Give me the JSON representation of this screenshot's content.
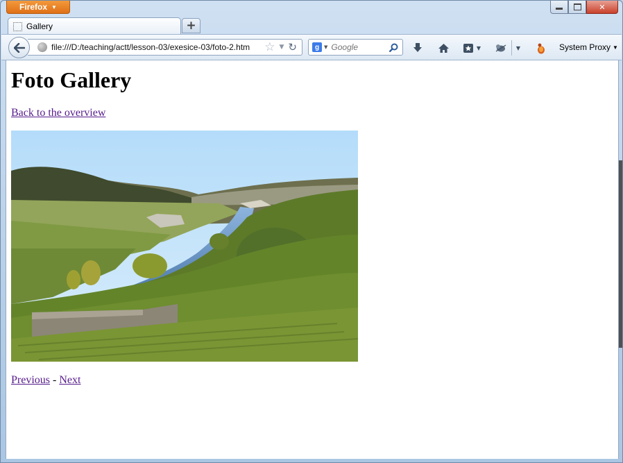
{
  "browser": {
    "app_button_label": "Firefox",
    "tab_title": "Gallery",
    "new_tab_label": "+",
    "url": "file:///D:/teaching/actt/lesson-03/exesice-03/foto-2.htm",
    "search_placeholder": "Google",
    "search_engine_letter": "g",
    "proxy_label": "System Proxy",
    "icons": [
      "back-arrow-icon",
      "globe-icon",
      "star-icon",
      "dropdown-icon",
      "reload-icon",
      "google-icon",
      "search-icon",
      "download-icon",
      "home-icon",
      "bookmarks-icon",
      "addon-icon",
      "firebug-icon",
      "minimize-icon",
      "maximize-icon",
      "close-icon"
    ]
  },
  "page": {
    "heading": "Foto Gallery",
    "back_link": "Back to the overview",
    "prev_link": "Previous",
    "separator": " - ",
    "next_link": "Next"
  }
}
